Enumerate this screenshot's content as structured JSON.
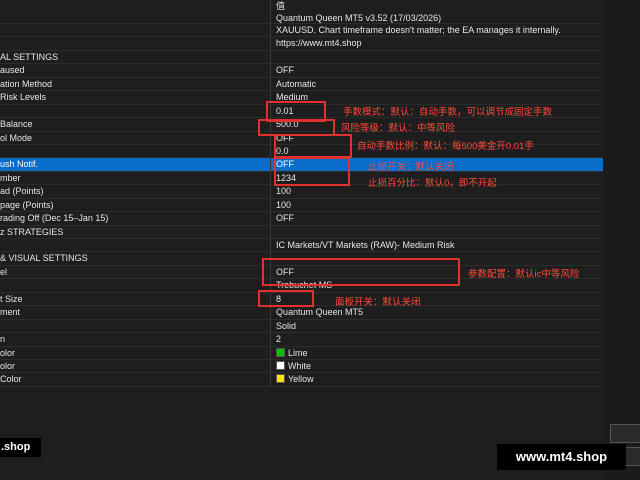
{
  "header": {
    "value_col": "值"
  },
  "rows": [
    {
      "name": "",
      "value": "Quantum Queen MT5 v3.52 (17/03/2026)"
    },
    {
      "name": "",
      "value": "XAUUSD. Chart timeframe doesn't matter; the EA manages it internally."
    },
    {
      "name": "",
      "value": "https://www.mt4.shop"
    },
    {
      "name": "AL SETTINGS",
      "value": ""
    },
    {
      "name": "aused",
      "value": "OFF"
    },
    {
      "name": "ation Method",
      "value": "Automatic"
    },
    {
      "name": "Risk Levels",
      "value": "Medium"
    },
    {
      "name": "",
      "value": "0.01"
    },
    {
      "name": "Balance",
      "value": "500.0"
    },
    {
      "name": "ol Mode",
      "value": "OFF"
    },
    {
      "name": "",
      "value": "0.0"
    },
    {
      "name": "ush Notif.",
      "value": "OFF",
      "selected": true
    },
    {
      "name": "mber",
      "value": "1234"
    },
    {
      "name": "ad (Points)",
      "value": "100"
    },
    {
      "name": "page (Points)",
      "value": "100"
    },
    {
      "name": "rading Off (Dec 15–Jan 15)",
      "value": "OFF"
    },
    {
      "name": "z STRATEGIES",
      "value": ""
    },
    {
      "name": "",
      "value": "IC Markets/VT Markets (RAW)- Medium Risk"
    },
    {
      "name": "& VISUAL SETTINGS",
      "value": ""
    },
    {
      "name": "el",
      "value": "OFF"
    },
    {
      "name": "",
      "value": "Trebuchet MS"
    },
    {
      "name": "t Size",
      "value": "8"
    },
    {
      "name": "ment",
      "value": "Quantum Queen MT5"
    },
    {
      "name": "",
      "value": "Solid"
    },
    {
      "name": "n",
      "value": "2"
    },
    {
      "name": "olor",
      "value": "Lime",
      "swatch": "#00c000"
    },
    {
      "name": "olor",
      "value": "White",
      "swatch": "#ffffff"
    },
    {
      "name": "Color",
      "value": "Yellow",
      "swatch": "#ffe600"
    }
  ],
  "annotations": [
    "手数模式：默认：自动手数，可以调节成固定手数",
    "风险等级：默认：中等风险",
    "自动手数比例：默认：每500美金开0.01手",
    "止损开关：默认关闭",
    "止损百分比：默认0，即不开起",
    "参数配置：默认ic中等风险",
    "面板开关：默认关闭"
  ],
  "badges": {
    "left": ".shop",
    "right": "www.mt4.shop"
  },
  "colors": {
    "selection": "#0a6cc9",
    "annotation": "#ff4a3a"
  }
}
